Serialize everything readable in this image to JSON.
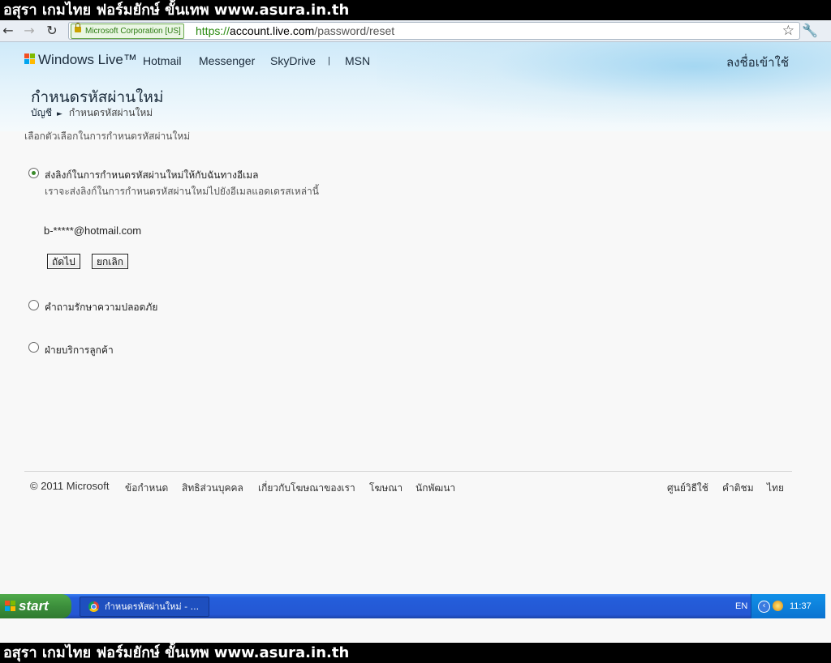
{
  "watermark": {
    "text": "อสุรา เกมไทย ฟอร์มยักษ์ ขั้นเทพ www.asura.in.th"
  },
  "browser": {
    "ev_label": "Microsoft Corporation [US]",
    "url_protocol": "https://",
    "url_host": "account.live.com",
    "url_path": "/password/reset"
  },
  "header": {
    "logo_text": "Windows Live™",
    "nav": [
      "Hotmail",
      "Messenger",
      "SkyDrive",
      "|",
      "MSN"
    ],
    "signin": "ลงชื่อเข้าใช้"
  },
  "page": {
    "title": "กำหนดรหัสผ่านใหม่",
    "breadcrumb": [
      "บัญชี",
      "►",
      "กำหนดรหัสผ่านใหม่"
    ],
    "intro": "เลือกตัวเลือกในการกำหนดรหัสผ่านใหม่"
  },
  "options": [
    {
      "label": "ส่งลิงก์ในการกำหนดรหัสผ่านใหม่ให้กับฉันทางอีเมล",
      "selected": true
    },
    {
      "label": "คำถามรักษาความปลอดภัย",
      "selected": false
    },
    {
      "label": "ฝ่ายบริการลูกค้า",
      "selected": false
    }
  ],
  "email_option": {
    "description": "เราจะส่งลิงก์ในการกำหนดรหัสผ่านใหม่ไปยังอีเมลแอดเดรสเหล่านี้",
    "address": "b-*****@hotmail.com",
    "next_label": "ถัดไป",
    "cancel_label": "ยกเลิก"
  },
  "footer": {
    "left": [
      "© 2011 Microsoft",
      "ข้อกำหนด",
      "สิทธิส่วนบุคคล",
      "เกี่ยวกับโฆษณาของเรา",
      "โฆษณา",
      "นักพัฒนา"
    ],
    "right": [
      "ศูนย์วิธีใช้",
      "คำติชม",
      "ไทย"
    ]
  },
  "taskbar": {
    "start_label": "start",
    "task_label": "กำหนดรหัสผ่านใหม่ - ...",
    "lang": "EN",
    "time": "11:37"
  },
  "colors": {
    "header_sky": "#cfeaf9",
    "taskbar_blue": "#245edb",
    "start_green": "#3c8f3c"
  }
}
